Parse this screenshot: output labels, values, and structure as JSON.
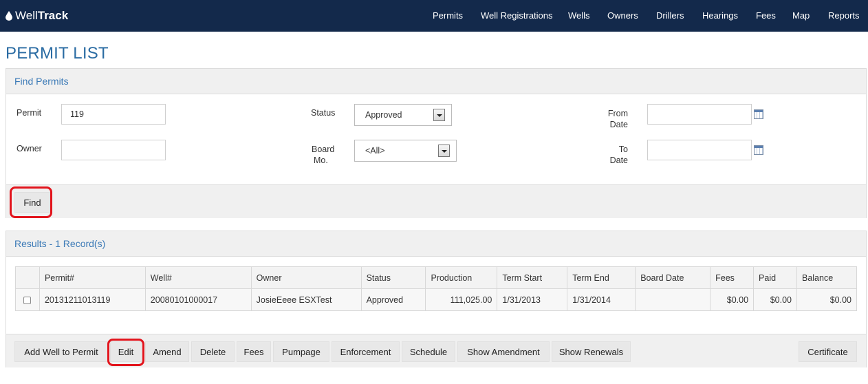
{
  "app": {
    "logo_part1": "Well",
    "logo_part2": "Track",
    "nav": [
      "Permits",
      "Well Registrations",
      "Wells",
      "Owners",
      "Drillers",
      "Hearings",
      "Fees",
      "Map",
      "Reports"
    ]
  },
  "page": {
    "title": "PERMIT LIST"
  },
  "find": {
    "header": "Find Permits",
    "permit_label": "Permit",
    "permit_value": "119",
    "owner_label": "Owner",
    "owner_value": "",
    "status_label": "Status",
    "status_value": "Approved",
    "board_label_1": "Board",
    "board_label_2": "Mo.",
    "board_value": "<All>",
    "from_label_1": "From",
    "from_label_2": "Date",
    "from_value": "",
    "to_label_1": "To",
    "to_label_2": "Date",
    "to_value": "",
    "find_button": "Find"
  },
  "results": {
    "header": "Results - 1 Record(s)",
    "columns": [
      "Permit#",
      "Well#",
      "Owner",
      "Status",
      "Production",
      "Term Start",
      "Term End",
      "Board Date",
      "Fees",
      "Paid",
      "Balance"
    ],
    "rows": [
      {
        "permit": "20131211013119",
        "well": "20080101000017",
        "owner": "JosieEeee ESXTest",
        "status": "Approved",
        "production": "111,025.00",
        "term_start": "1/31/2013",
        "term_end": "1/31/2014",
        "board_date": "",
        "fees": "$0.00",
        "paid": "$0.00",
        "balance": "$0.00"
      }
    ],
    "actions": {
      "add_well": "Add Well to Permit",
      "edit": "Edit",
      "amend": "Amend",
      "delete": "Delete",
      "fees": "Fees",
      "pumpage": "Pumpage",
      "enforcement": "Enforcement",
      "schedule": "Schedule",
      "show_amendment": "Show Amendment",
      "show_renewals": "Show Renewals",
      "certificate": "Certificate"
    }
  },
  "colors": {
    "nav_bg": "#13294b",
    "title_blue": "#2b6ca3",
    "panel_header_text": "#3a79b6",
    "highlight_ring": "#e2141c"
  }
}
